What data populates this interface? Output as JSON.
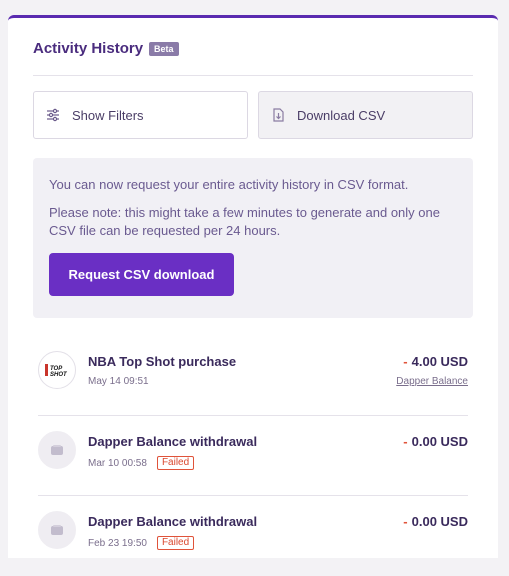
{
  "header": {
    "title": "Activity History",
    "badge": "Beta"
  },
  "toolbar": {
    "filters_label": "Show Filters",
    "download_label": "Download CSV"
  },
  "info": {
    "line1": "You can now request your entire activity history in CSV format.",
    "line2": "Please note: this might take a few minutes to generate and only one CSV file can be requested per 24 hours.",
    "request_label": "Request CSV download"
  },
  "activity": [
    {
      "title": "NBA Top Shot purchase",
      "date": "May 14 09:51",
      "sign": "-",
      "amount": "4.00 USD",
      "source": "Dapper Balance",
      "status": "",
      "icon": "nba-top-shot-logo"
    },
    {
      "title": "Dapper Balance withdrawal",
      "date": "Mar 10 00:58",
      "sign": "-",
      "amount": "0.00 USD",
      "source": "",
      "status": "Failed",
      "icon": "wallet-icon"
    },
    {
      "title": "Dapper Balance withdrawal",
      "date": "Feb 23 19:50",
      "sign": "-",
      "amount": "0.00 USD",
      "source": "",
      "status": "Failed",
      "icon": "wallet-icon"
    }
  ],
  "colors": {
    "accent": "#6a2fc4",
    "error": "#e0533a"
  }
}
